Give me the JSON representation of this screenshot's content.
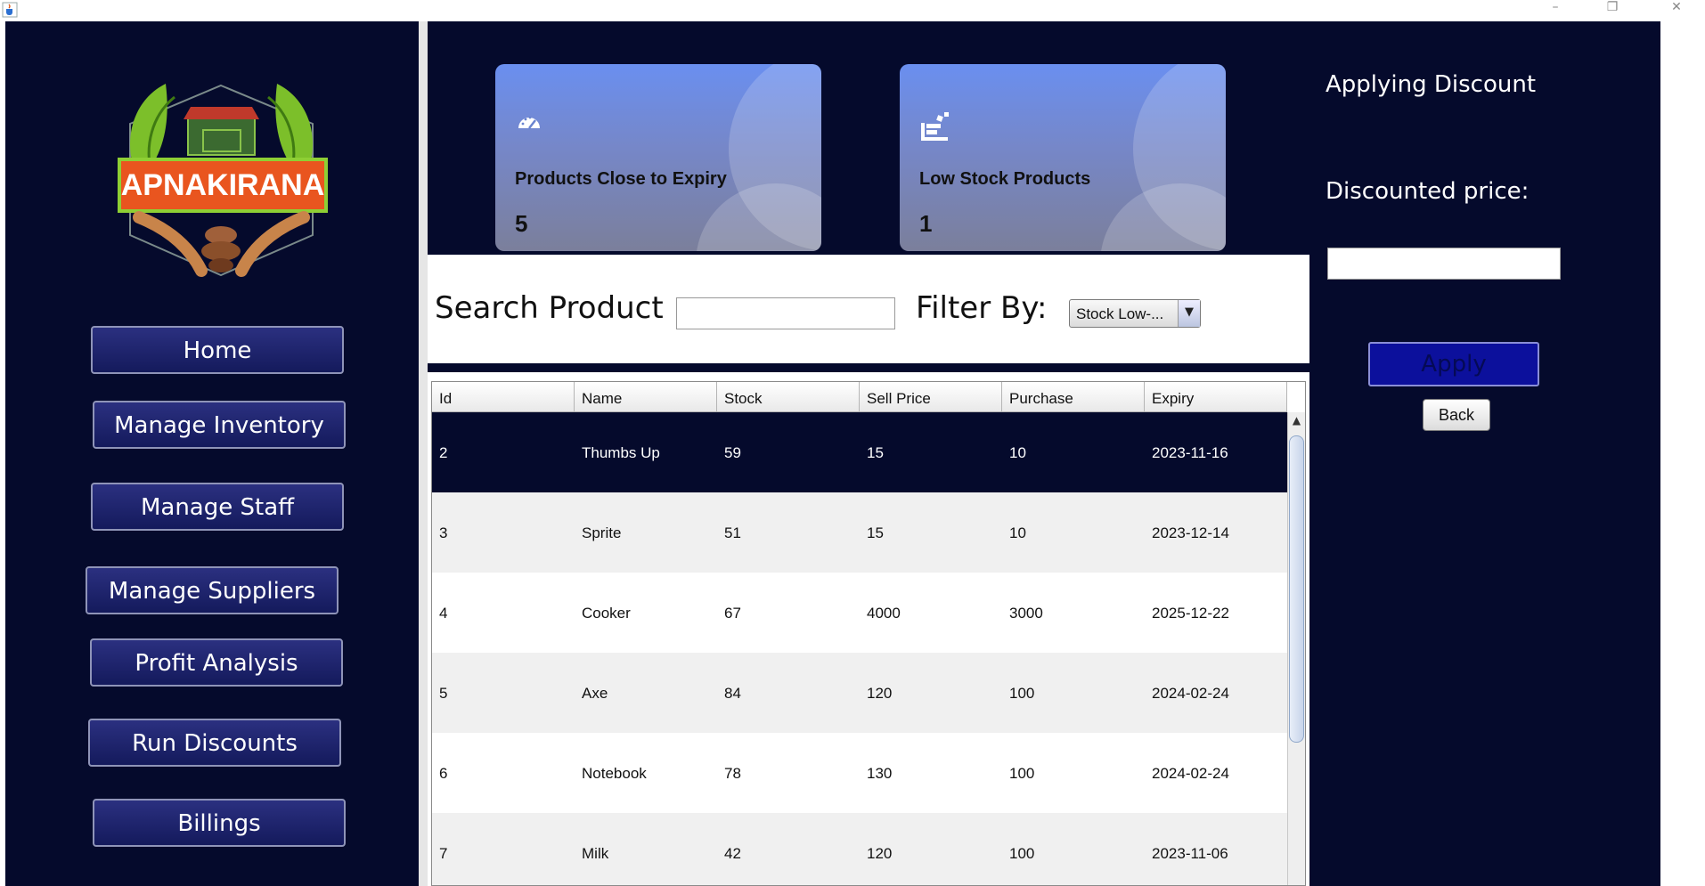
{
  "app": {
    "logo_text": "APNAKIRANA",
    "colors": {
      "sidebar_bg": "#050a2c",
      "card_gradient_top": "#6a8ff0",
      "apply_bg": "#0c109c"
    }
  },
  "titlebar": {
    "app_icon": "java-cup-icon",
    "minimize_icon": "minimize-icon",
    "restore_icon": "restore-icon",
    "close_icon": "close-icon",
    "minimize_glyph": "–",
    "restore_glyph": "❐",
    "close_glyph": "✕"
  },
  "sidebar": {
    "items": [
      {
        "label": "Home"
      },
      {
        "label": "Manage Inventory"
      },
      {
        "label": "Manage Staff"
      },
      {
        "label": "Manage Suppliers"
      },
      {
        "label": "Profit Analysis"
      },
      {
        "label": "Run Discounts"
      },
      {
        "label": "Billings"
      }
    ]
  },
  "cards": [
    {
      "label": "Products Close to Expiry",
      "count": "5",
      "icon": "speedometer-icon"
    },
    {
      "label": "Low Stock Products",
      "count": "1",
      "icon": "stock-chart-icon"
    }
  ],
  "search": {
    "label": "Search Product",
    "value": "",
    "filter_label": "Filter By:",
    "filter_value": "Stock Low-...",
    "arrow_glyph": "▼"
  },
  "table": {
    "columns": [
      "Id",
      "Name",
      "Stock",
      "Sell Price",
      "Purchase",
      "Expiry"
    ],
    "rows": [
      [
        "2",
        "Thumbs Up",
        "59",
        "15",
        "10",
        "2023-11-16"
      ],
      [
        "3",
        "Sprite",
        "51",
        "15",
        "10",
        "2023-12-14"
      ],
      [
        "4",
        "Cooker",
        "67",
        "4000",
        "3000",
        "2025-12-22"
      ],
      [
        "5",
        "Axe",
        "84",
        "120",
        "100",
        "2024-02-24"
      ],
      [
        "6",
        "Notebook",
        "78",
        "130",
        "100",
        "2024-02-24"
      ],
      [
        "7",
        "Milk",
        "42",
        "120",
        "100",
        "2023-11-06"
      ]
    ],
    "selected_row": 0,
    "scroll_up_glyph": "▲"
  },
  "discount_panel": {
    "title": "Applying Discount",
    "price_label": "Discounted price:",
    "price_value": "",
    "apply_label": "Apply",
    "back_label": "Back"
  }
}
